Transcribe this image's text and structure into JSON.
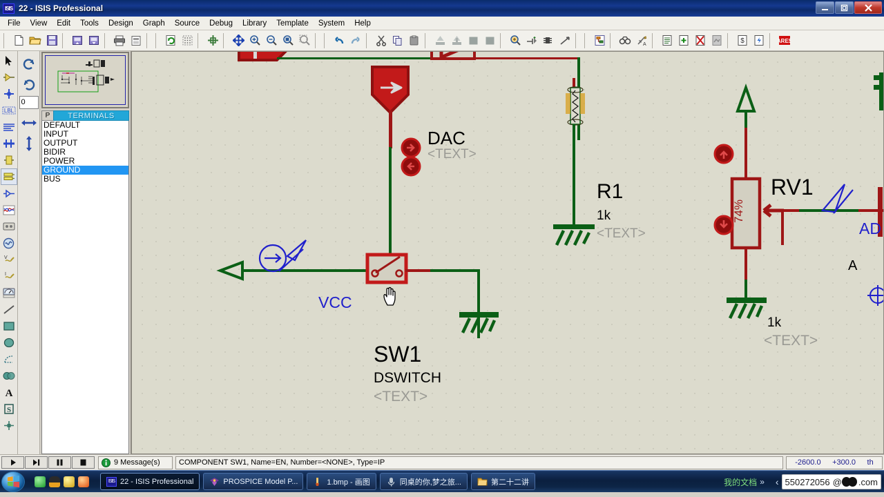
{
  "window": {
    "title": "22 - ISIS Professional",
    "icon": "isis-icon",
    "buttons": {
      "minimize": "–",
      "restore": "❐",
      "close": "✕"
    }
  },
  "menubar": {
    "items": [
      {
        "label": "File",
        "accel": "F"
      },
      {
        "label": "View",
        "accel": "V"
      },
      {
        "label": "Edit",
        "accel": "E"
      },
      {
        "label": "Tools",
        "accel": "T"
      },
      {
        "label": "Design",
        "accel": "D"
      },
      {
        "label": "Graph",
        "accel": "G"
      },
      {
        "label": "Source",
        "accel": "S"
      },
      {
        "label": "Debug",
        "accel": "u"
      },
      {
        "label": "Library",
        "accel": "L"
      },
      {
        "label": "Template",
        "accel": "m"
      },
      {
        "label": "System",
        "accel": "y"
      },
      {
        "label": "Help",
        "accel": "H"
      }
    ]
  },
  "toolbar": {
    "groups": [
      [
        "new-file-icon",
        "open-folder-icon",
        "save-icon"
      ],
      [
        "import-section-icon",
        "export-section-icon"
      ],
      [
        "print-icon",
        "print-area-icon"
      ],
      [
        "refresh-display-icon",
        "toggle-grid-icon"
      ],
      [
        "origin-icon"
      ],
      [
        "pan-icon",
        "zoom-in-icon",
        "zoom-out-icon",
        "zoom-all-icon",
        "zoom-area-icon"
      ],
      [
        "undo-icon",
        "redo-icon"
      ],
      [
        "cut-icon",
        "copy-icon",
        "paste-icon"
      ],
      [
        "block-copy-icon",
        "block-move-icon",
        "block-rotate-icon",
        "block-delete-icon"
      ],
      [
        "pick-device-icon",
        "make-device-icon",
        "packaging-tool-icon",
        "decompose-icon"
      ],
      [
        "hierarchy-icon"
      ],
      [
        "search-icon",
        "property-assign-icon"
      ],
      [
        "bill-of-materials-icon",
        "new-sheet-icon",
        "remove-sheet-icon",
        "exit-sheet-icon"
      ],
      [
        "netlist-icon",
        "electrical-rules-icon"
      ],
      [
        "ares-icon"
      ]
    ]
  },
  "lefttools": {
    "items": [
      {
        "name": "selection-mode",
        "icon": "arrow-cursor-icon",
        "selected": false
      },
      {
        "name": "component-mode",
        "icon": "component-icon",
        "selected": false
      },
      {
        "name": "junction-dot-mode",
        "icon": "junction-dot-icon",
        "selected": false
      },
      {
        "name": "wire-label-mode",
        "icon": "label-lbl-icon",
        "selected": false
      },
      {
        "name": "text-script-mode",
        "icon": "text-script-icon",
        "selected": false
      },
      {
        "name": "buses-mode",
        "icon": "bus-icon",
        "selected": false
      },
      {
        "name": "subcircuit-mode",
        "icon": "subcircuit-icon",
        "selected": false
      },
      {
        "name": "terminals-mode",
        "icon": "terminal-icon",
        "selected": true
      },
      {
        "name": "device-pin-mode",
        "icon": "device-pin-icon",
        "selected": false
      },
      {
        "name": "graph-mode",
        "icon": "graph-chart-icon",
        "selected": false
      },
      {
        "name": "tape-recorder-mode",
        "icon": "tape-recorder-icon",
        "selected": false
      },
      {
        "name": "generator-mode",
        "icon": "generator-icon",
        "selected": false
      },
      {
        "name": "voltage-probe-mode",
        "icon": "voltage-probe-icon",
        "selected": false
      },
      {
        "name": "current-probe-mode",
        "icon": "current-probe-icon",
        "selected": false
      },
      {
        "name": "virtual-instruments-mode",
        "icon": "virtual-instrument-icon",
        "selected": false
      },
      {
        "name": "2d-line-mode",
        "icon": "line-icon",
        "selected": false
      },
      {
        "name": "2d-box-mode",
        "icon": "box-icon",
        "selected": false
      },
      {
        "name": "2d-circle-mode",
        "icon": "circle-icon",
        "selected": false
      },
      {
        "name": "2d-arc-mode",
        "icon": "arc-icon",
        "selected": false
      },
      {
        "name": "2d-path-mode",
        "icon": "path-icon",
        "selected": false
      },
      {
        "name": "2d-text-mode",
        "icon": "text-a-icon",
        "selected": false
      },
      {
        "name": "symbol-mode",
        "icon": "symbol-s-icon",
        "selected": false
      },
      {
        "name": "marker-mode",
        "icon": "marker-icon",
        "selected": false
      }
    ]
  },
  "rotation": {
    "rotate_cw": "rotate-clockwise-icon",
    "rotate_ccw": "rotate-counterclockwise-icon",
    "angle_value": "0",
    "mirror_x": "mirror-horizontal-icon",
    "mirror_y": "mirror-vertical-icon"
  },
  "objectselector": {
    "pick_button": "P",
    "title": "TERMINALS",
    "items": [
      {
        "label": "DEFAULT",
        "selected": false
      },
      {
        "label": "INPUT",
        "selected": false
      },
      {
        "label": "OUTPUT",
        "selected": false
      },
      {
        "label": "BIDIR",
        "selected": false
      },
      {
        "label": "POWER",
        "selected": false
      },
      {
        "label": "GROUND",
        "selected": true
      },
      {
        "label": "BUS",
        "selected": false
      }
    ]
  },
  "schematic": {
    "components": [
      {
        "id": "DAC",
        "ref": "DAC",
        "text": "<TEXT>"
      },
      {
        "id": "R1",
        "ref": "R1",
        "value": "1k",
        "text": "<TEXT>"
      },
      {
        "id": "RV1",
        "ref": "RV1",
        "value": "1k",
        "text": "<TEXT>",
        "wiper": "74%"
      },
      {
        "id": "SW1",
        "ref": "SW1",
        "value": "DSWITCH",
        "text": "<TEXT>"
      }
    ],
    "labels": [
      {
        "name": "vcc-terminal-label",
        "text": "VCC"
      },
      {
        "name": "a-net-label",
        "text": "A"
      },
      {
        "name": "ad-terminal-label",
        "text": "AD"
      }
    ],
    "colors": {
      "wire_green": "#0b5f16",
      "wire_red": "#9e1616",
      "component_red": "#c21a1a",
      "label_blue": "#2020cc",
      "text_gray": "#9a9a94",
      "canvas": "#dcdbcd"
    }
  },
  "statusbar": {
    "animation": {
      "play": "play-icon",
      "step": "step-icon",
      "pause": "pause-icon",
      "stop": "stop-icon"
    },
    "messages": "9 Message(s)",
    "messages_icon": "info-icon",
    "status_text": "COMPONENT SW1, Name=EN, Number=<NONE>, Type=IP",
    "coord_x": "-2600.0",
    "coord_y": "+300.0",
    "coord_unit": "th"
  },
  "taskbar": {
    "start": "windows-start-orb",
    "quicklaunch": [
      {
        "name": "ql-green-icon"
      },
      {
        "name": "ql-penguin-icon"
      },
      {
        "name": "ql-yellow-icon"
      },
      {
        "name": "ql-orange-icon"
      }
    ],
    "tasks": [
      {
        "label": "22 - ISIS Professional",
        "icon": "isis-icon",
        "active": true
      },
      {
        "label": "PROSPICE Model P...",
        "icon": "prospice-icon",
        "active": false
      },
      {
        "label": "1.bmp - 画图",
        "icon": "paint-icon",
        "active": false
      },
      {
        "label": "同桌的你,梦之旅...",
        "icon": "media-icon",
        "active": false
      },
      {
        "label": "第二十二讲",
        "icon": "folder-icon",
        "active": false
      }
    ],
    "tray": {
      "docs_label": "我的文档",
      "overflow": "»",
      "collapse": "‹",
      "qq_number": "550272056",
      "qq_suffix": ".com",
      "qq_at": "@"
    }
  }
}
